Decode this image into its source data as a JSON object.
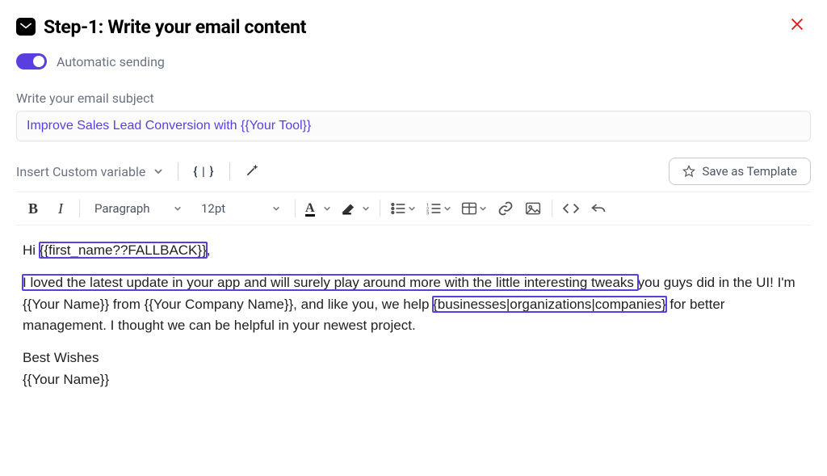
{
  "header": {
    "title": "Step-1:  Write your email content"
  },
  "toggle": {
    "label": "Automatic sending"
  },
  "subject": {
    "label": "Write your email subject",
    "value": "Improve Sales Lead Conversion with {{Your Tool}}"
  },
  "toolbar": {
    "insert_variable": "Insert Custom variable",
    "save_template": "Save as Template",
    "paragraph": "Paragraph",
    "font_size": "12pt"
  },
  "body": {
    "greet_prefix": "Hi ",
    "greet_var": "{{first_name??FALLBACK}}",
    "greet_suffix": ",",
    "p1_hl1": "I loved the latest update in your app and will surely play around more with the little interesting tweaks ",
    "p1_mid1": "you guys did in the UI! I'm {{Your Name}} from {{Your Company Name}}, and like you, we help ",
    "p1_hl2": "{businesses|organizations|companies}",
    "p1_tail": " for better management. I thought we can be helpful in your newest project.",
    "sig1": "Best Wishes",
    "sig2": "{{Your Name}}"
  }
}
